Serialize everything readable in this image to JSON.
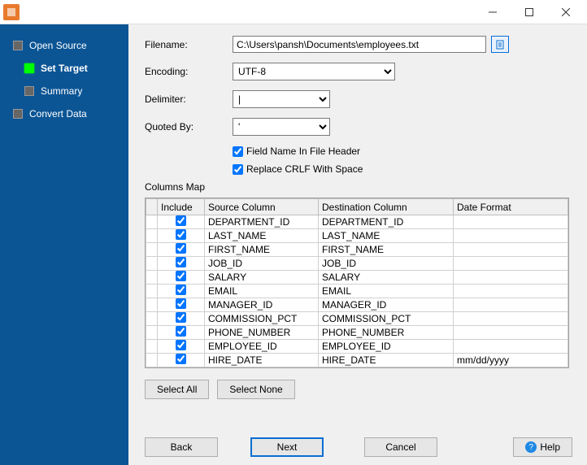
{
  "sidebar": {
    "items": [
      {
        "label": "Open Source"
      },
      {
        "label": "Set Target"
      },
      {
        "label": "Summary"
      },
      {
        "label": "Convert Data"
      }
    ]
  },
  "form": {
    "filename_label": "Filename:",
    "filename_value": "C:\\Users\\pansh\\Documents\\employees.txt",
    "encoding_label": "Encoding:",
    "encoding_value": "UTF-8",
    "delimiter_label": "Delimiter:",
    "delimiter_value": "|",
    "quoted_label": "Quoted By:",
    "quoted_value": "'",
    "chk_header": "Field Name In File Header",
    "chk_crlf": "Replace CRLF With Space",
    "columns_map_label": "Columns Map"
  },
  "grid": {
    "headers": {
      "include": "Include",
      "source": "Source Column",
      "dest": "Destination Column",
      "date": "Date Format"
    },
    "rows": [
      {
        "inc": true,
        "src": "DEPARTMENT_ID",
        "dst": "DEPARTMENT_ID",
        "fmt": ""
      },
      {
        "inc": true,
        "src": "LAST_NAME",
        "dst": "LAST_NAME",
        "fmt": ""
      },
      {
        "inc": true,
        "src": "FIRST_NAME",
        "dst": "FIRST_NAME",
        "fmt": ""
      },
      {
        "inc": true,
        "src": "JOB_ID",
        "dst": "JOB_ID",
        "fmt": ""
      },
      {
        "inc": true,
        "src": "SALARY",
        "dst": "SALARY",
        "fmt": ""
      },
      {
        "inc": true,
        "src": "EMAIL",
        "dst": "EMAIL",
        "fmt": ""
      },
      {
        "inc": true,
        "src": "MANAGER_ID",
        "dst": "MANAGER_ID",
        "fmt": ""
      },
      {
        "inc": true,
        "src": "COMMISSION_PCT",
        "dst": "COMMISSION_PCT",
        "fmt": ""
      },
      {
        "inc": true,
        "src": "PHONE_NUMBER",
        "dst": "PHONE_NUMBER",
        "fmt": ""
      },
      {
        "inc": true,
        "src": "EMPLOYEE_ID",
        "dst": "EMPLOYEE_ID",
        "fmt": ""
      },
      {
        "inc": true,
        "src": "HIRE_DATE",
        "dst": "HIRE_DATE",
        "fmt": "mm/dd/yyyy"
      }
    ]
  },
  "buttons": {
    "select_all": "Select All",
    "select_none": "Select None",
    "back": "Back",
    "next": "Next",
    "cancel": "Cancel",
    "help": "Help"
  }
}
